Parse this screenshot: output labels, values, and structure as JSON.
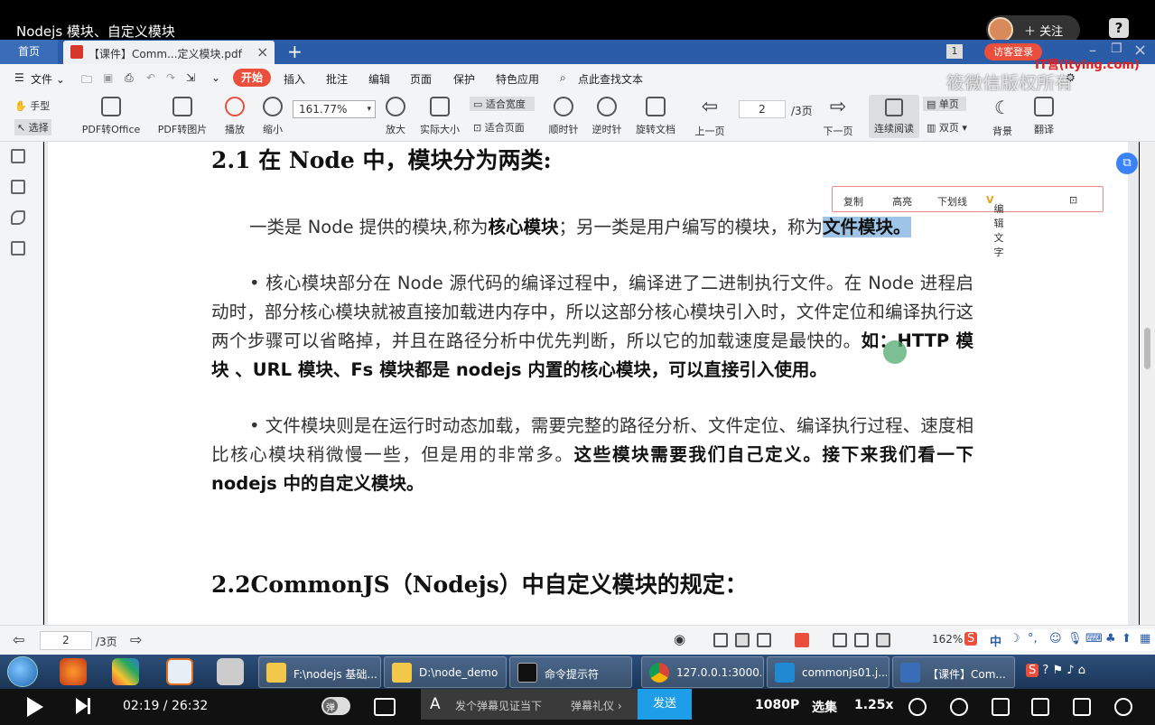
{
  "video_title": "Nodejs 模块、自定义模块",
  "follow_label": "关注",
  "help_label": "?",
  "tabs": {
    "home": "首页",
    "doc": "【课件】Comm...定义模块.pdf",
    "close": "×",
    "add": "+"
  },
  "tabbar_right": {
    "page_badge": "1",
    "guest_login": "访客登录"
  },
  "menu": {
    "file": "文件",
    "items": [
      "开始",
      "插入",
      "批注",
      "编辑",
      "页面",
      "保护",
      "特色应用"
    ],
    "search": "点此查找文本"
  },
  "watermark": {
    "logo": "IT营(itying.com)",
    "text": "筱微信版权所有"
  },
  "toolbar": {
    "hand": "手型",
    "select": "选择",
    "pdf_to_office": "PDF转Office",
    "pdf_to_image": "PDF转图片",
    "play": "播放",
    "zoom_out": "缩小",
    "zoom_value": "161.77%",
    "zoom_in": "放大",
    "actual_size": "实际大小",
    "fit_width": "适合宽度",
    "fit_page": "适合页面",
    "rotate_cw": "顺时针",
    "rotate_ccw": "逆时针",
    "rotate_doc": "旋转文档",
    "prev_page": "上一页",
    "page_current": "2",
    "page_total": "/3页",
    "next_page": "下一页",
    "continuous": "连续阅读",
    "single": "单页",
    "double": "双页",
    "background": "背景",
    "translate": "翻译"
  },
  "selection_toolbar": [
    "复制",
    "高亮",
    "下划线",
    "编辑文字"
  ],
  "document": {
    "heading1": "2.1 在 Node 中，模块分为两类:",
    "para1_a": "一类是 Node 提供的模块,称为",
    "para1_b": "核心模块",
    "para1_c": "；另一类是用户编写的模块，称为",
    "para1_d": "文件模块。",
    "para2": "• 核心模块部分在 Node 源代码的编译过程中，编译进了二进制执行文件。在 Node 进程启动时，部分核心模块就被直接加载进内存中，所以这部分核心模块引入时，文件定位和编译执行这两个步骤可以省略掉，并且在路径分析中优先判断，所以它的加载速度是最快的。",
    "para2_bold": "如：HTTP 模块 、URL 模块、Fs 模块都是 nodejs 内置的核心模块，可以直接引入使用。",
    "para3": "• 文件模块则是在运行时动态加载，需要完整的路径分析、文件定位、编译执行过程、速度相比核心模块稍微慢一些，但是用的非常多。",
    "para3_bold": "这些模块需要我们自己定义。接下来我们看一下 nodejs 中的自定义模块。",
    "heading2": "2.2CommonJS（Nodejs）中自定义模块的规定："
  },
  "statusbar": {
    "page_current": "2",
    "page_total": "/3页",
    "zoom": "162%"
  },
  "ime": {
    "label": "中"
  },
  "taskbar": {
    "items": [
      "F:\\nodejs 基础...",
      "D:\\node_demo",
      "命令提示符",
      "127.0.0.1:3000...",
      "commonjs01.j...",
      "【课件】Com..."
    ]
  },
  "player": {
    "time": "02:19 / 26:32",
    "danmu_placeholder": "发个弹幕见证当下",
    "danmu_etiquette": "弹幕礼仪 ›",
    "send": "发送",
    "quality": "1080P",
    "episodes": "选集",
    "speed": "1.25x",
    "danmu_a": "A",
    "danmu_toggle": "弹"
  },
  "colors": {
    "wps_blue": "#2b5ca8",
    "accent_red": "#e94f3c",
    "send_blue": "#1e9ee8"
  }
}
